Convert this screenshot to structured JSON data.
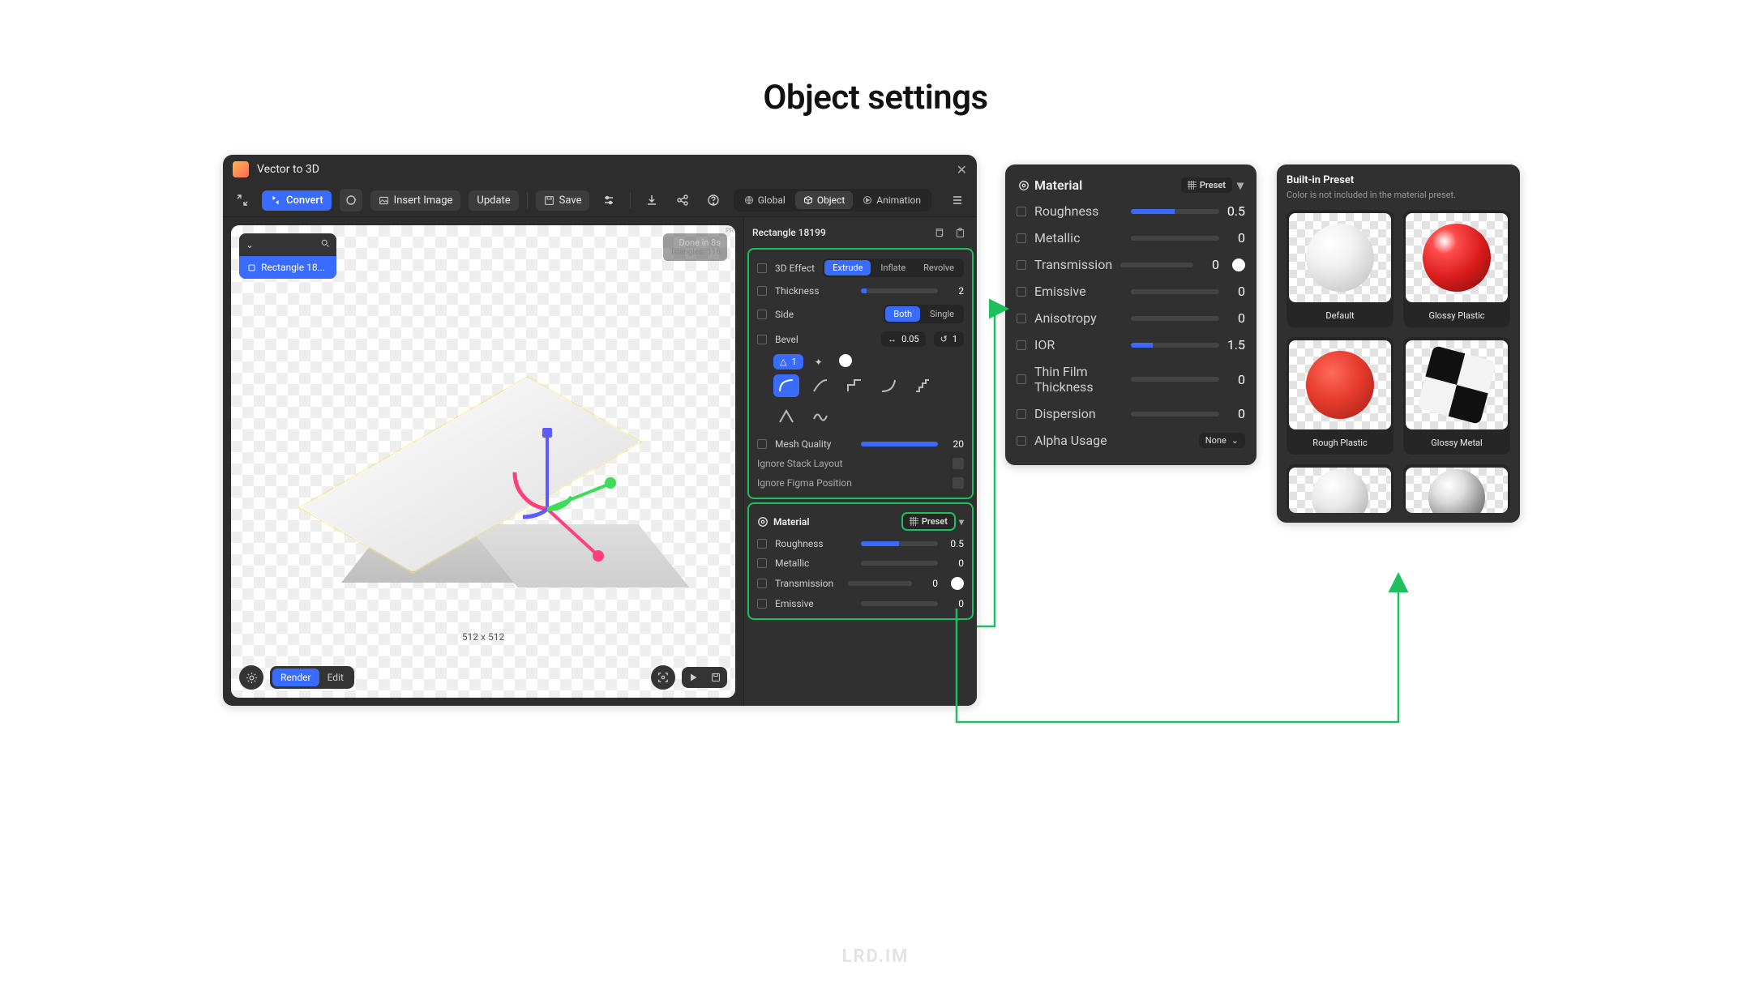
{
  "page": {
    "heading": "Object settings",
    "watermark": "LRD.IM"
  },
  "window": {
    "title": "Vector to 3D",
    "toolbar": {
      "convert": "Convert",
      "insert_image": "Insert Image",
      "update": "Update",
      "save": "Save"
    },
    "tabs": {
      "global": "Global",
      "object": "Object",
      "animation": "Animation"
    },
    "layers": {
      "active": "Rectangle 18...",
      "active_full": "Rectangle 18199"
    },
    "status": {
      "line1": "Done in 8s",
      "line2": "Triangles: 116"
    },
    "dims": "512 x 512",
    "bottom": {
      "render": "Render",
      "edit": "Edit"
    }
  },
  "object_panel": {
    "title": "Rectangle 18199",
    "effect": {
      "label": "3D Effect",
      "options": [
        "Extrude",
        "Inflate",
        "Revolve"
      ],
      "selected": "Extrude"
    },
    "thickness": {
      "label": "Thickness",
      "value": 2
    },
    "side": {
      "label": "Side",
      "options": [
        "Both",
        "Single"
      ],
      "selected": "Both"
    },
    "bevel": {
      "label": "Bevel",
      "width_icon": "↔",
      "width": 0.05,
      "repeat_icon": "↺",
      "repeat": 1,
      "angle_icon": "△",
      "angle": 1
    },
    "mesh_quality": {
      "label": "Mesh Quality",
      "value": 20
    },
    "ignore_stack": "Ignore Stack Layout",
    "ignore_figma": "Ignore Figma Position",
    "material": {
      "title": "Material",
      "preset_label": "Preset",
      "roughness": {
        "label": "Roughness",
        "value": 0.5
      },
      "metallic": {
        "label": "Metallic",
        "value": 0
      },
      "transmission": {
        "label": "Transmission",
        "value": 0
      },
      "emissive": {
        "label": "Emissive",
        "value": 0
      }
    }
  },
  "material_panel": {
    "title": "Material",
    "preset_label": "Preset",
    "roughness": {
      "label": "Roughness",
      "value": 0.5
    },
    "metallic": {
      "label": "Metallic",
      "value": 0
    },
    "transmission": {
      "label": "Transmission",
      "value": 0
    },
    "emissive": {
      "label": "Emissive",
      "value": 0
    },
    "anisotropy": {
      "label": "Anisotropy",
      "value": 0
    },
    "ior": {
      "label": "IOR",
      "value": 1.5
    },
    "thin_film": {
      "label": "Thin Film Thickness",
      "value": 0
    },
    "dispersion": {
      "label": "Dispersion",
      "value": 0
    },
    "alpha_usage": {
      "label": "Alpha Usage",
      "value": "None"
    }
  },
  "preset_panel": {
    "title": "Built-in Preset",
    "subtitle": "Color is not included in the material preset.",
    "items": [
      "Default",
      "Glossy Plastic",
      "Rough Plastic",
      "Glossy Metal"
    ]
  }
}
